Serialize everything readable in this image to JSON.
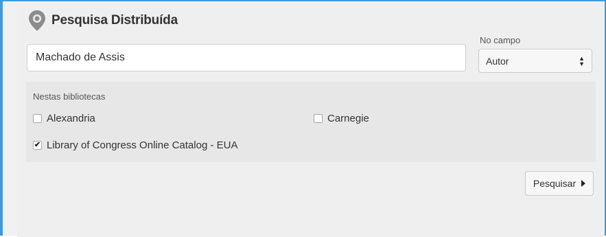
{
  "search": {
    "title": "Pesquisa Distribuída",
    "query_value": "Machado de Assis",
    "field_label": "No campo",
    "field_selected": "Autor",
    "submit_label": "Pesquisar"
  },
  "libraries": {
    "label": "Nestas bibliotecas",
    "options": [
      {
        "label": "Alexandria",
        "checked": false
      },
      {
        "label": "Carnegie",
        "checked": false
      },
      {
        "label": "Library of Congress Online Catalog - EUA",
        "checked": true
      }
    ]
  },
  "icons": {
    "title_icon": "map-pin-icon",
    "select_icon": "up-down-arrows-icon",
    "submit_icon": "caret-right-icon"
  },
  "colors": {
    "accent_border": "#3d9ae0",
    "panel_background": "#efefef",
    "libraries_background": "#e7e7e7",
    "icon_gray": "#8c8c8c"
  }
}
